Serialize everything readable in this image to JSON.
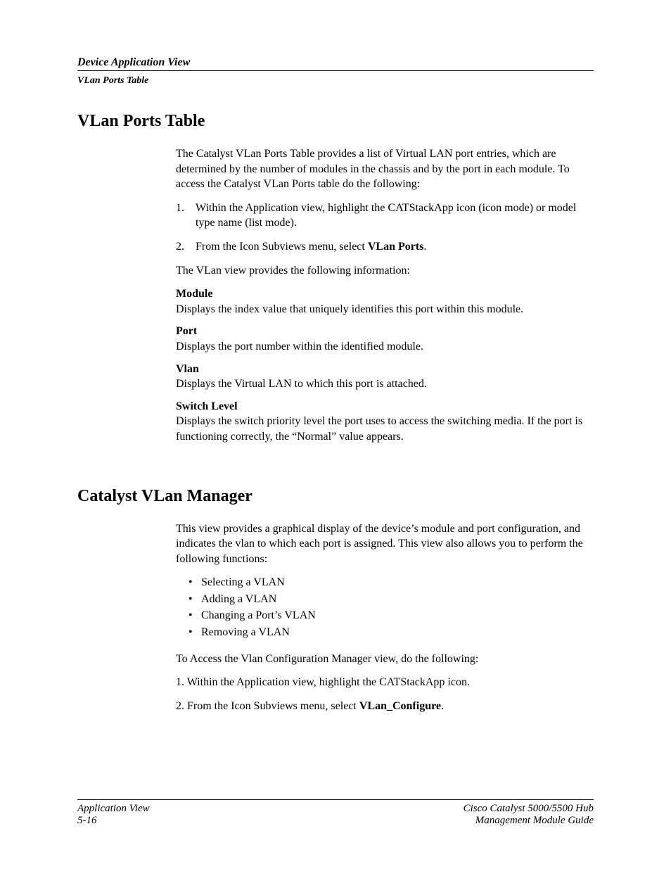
{
  "header": {
    "title": "Device Application View",
    "subtitle": "VLan Ports Table"
  },
  "section1": {
    "title": "VLan Ports Table",
    "intro": "The Catalyst VLan Ports Table provides a list of Virtual LAN port entries, which are determined by the number of modules in the chassis and by the port in each module. To access the Catalyst VLan Ports table do the following:",
    "step1_num": "1.",
    "step1_text": "Within the Application view, highlight the CATStackApp icon (icon mode) or model type name (list mode).",
    "step2_num": "2.",
    "step2_prefix": "From the Icon Subviews menu, select ",
    "step2_bold": "VLan Ports",
    "step2_suffix": ".",
    "following": "The VLan view provides the following information:",
    "fields": {
      "module_label": "Module",
      "module_desc": "Displays the index value that uniquely identifies this port within this module.",
      "port_label": "Port",
      "port_desc": "Displays the port number within the identified module.",
      "vlan_label": "Vlan",
      "vlan_desc": "Displays the Virtual LAN to which this port is attached.",
      "switch_label": "Switch Level",
      "switch_desc": "Displays the switch priority level the port uses to access the switching media. If the port is functioning correctly, the “Normal” value appears."
    }
  },
  "section2": {
    "title": "Catalyst VLan Manager",
    "intro": "This view provides a graphical display of the device’s module and port configuration, and indicates the vlan to which each port is assigned. This view also allows you to perform the following functions:",
    "bullets": {
      "b1": "Selecting a VLAN",
      "b2": "Adding a VLAN",
      "b3": "Changing a Port’s VLAN",
      "b4": "Removing a VLAN"
    },
    "access": "To Access the Vlan Configuration Manager view, do the following:",
    "step1": "1. Within the Application view, highlight the CATStackApp icon.",
    "step2_prefix": "2. From the Icon Subviews menu, select ",
    "step2_bold": "VLan_Configure",
    "step2_suffix": "."
  },
  "footer": {
    "left1": "Application View",
    "left2": "5-16",
    "right1": "Cisco Catalyst 5000/5500 Hub",
    "right2": "Management Module Guide"
  }
}
